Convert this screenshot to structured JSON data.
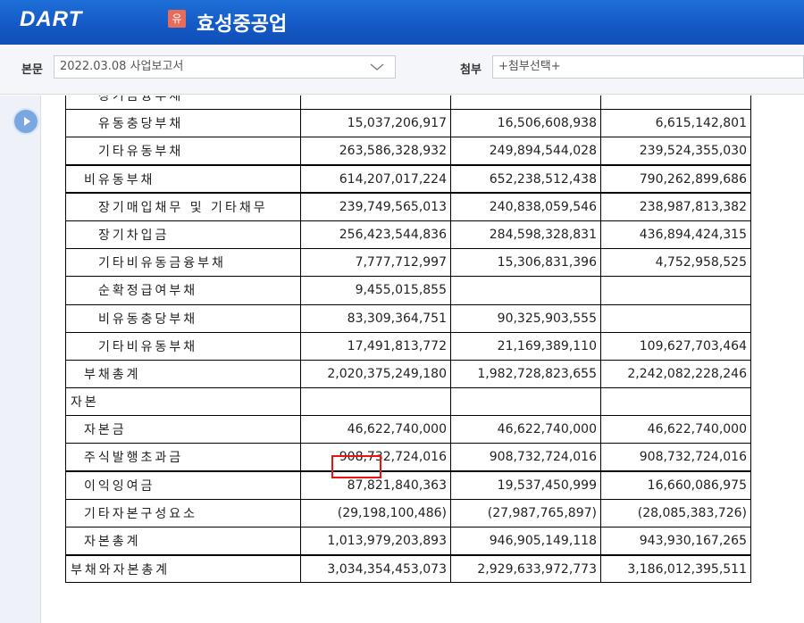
{
  "header": {
    "logo": "DART",
    "badge": "유",
    "company": "효성중공업"
  },
  "toolbar": {
    "main_label": "본문",
    "main_select": "2022.03.08   사업보고서",
    "attach_label": "첨부",
    "attach_select": "+첨부선택+"
  },
  "table": {
    "rows": [
      {
        "label": "장기금융부채 (partially visible)",
        "indent": 2,
        "v1": "",
        "v2": "",
        "v3": ""
      },
      {
        "label": "유동충당부채",
        "indent": 2,
        "v1": "15,037,206,917",
        "v2": "16,506,608,938",
        "v3": "6,615,142,801"
      },
      {
        "label": "기타유동부채",
        "indent": 2,
        "v1": "263,586,328,932",
        "v2": "249,894,544,028",
        "v3": "239,524,355,030"
      },
      {
        "label": "비유동부채",
        "indent": 1,
        "v1": "614,207,017,224",
        "v2": "652,238,512,438",
        "v3": "790,262,899,686"
      },
      {
        "label": "장기매입채무 및 기타채무",
        "indent": 2,
        "v1": "239,749,565,013",
        "v2": "240,838,059,546",
        "v3": "238,987,813,382"
      },
      {
        "label": "장기차입금",
        "indent": 2,
        "v1": "256,423,544,836",
        "v2": "284,598,328,831",
        "v3": "436,894,424,315"
      },
      {
        "label": "기타비유동금융부채",
        "indent": 2,
        "v1": "7,777,712,997",
        "v2": "15,306,831,396",
        "v3": "4,752,958,525"
      },
      {
        "label": "순확정급여부채",
        "indent": 2,
        "v1": "9,455,015,855",
        "v2": "",
        "v3": ""
      },
      {
        "label": "비유동충당부채",
        "indent": 2,
        "v1": "83,309,364,751",
        "v2": "90,325,903,555",
        "v3": ""
      },
      {
        "label": "기타비유동부채",
        "indent": 2,
        "v1": "17,491,813,772",
        "v2": "21,169,389,110",
        "v3": "109,627,703,464"
      },
      {
        "label": "부채총계",
        "indent": 1,
        "v1": "2,020,375,249,180",
        "v2": "1,982,728,823,655",
        "v3": "2,242,082,228,246"
      },
      {
        "label": "자본",
        "indent": 0,
        "v1": "",
        "v2": "",
        "v3": ""
      },
      {
        "label": "자본금",
        "indent": 1,
        "v1": "46,622,740,000",
        "v2": "46,622,740,000",
        "v3": "46,622,740,000"
      },
      {
        "label": "주식발행초과금",
        "indent": 1,
        "v1": "908,732,724,016",
        "v2": "908,732,724,016",
        "v3": "908,732,724,016"
      },
      {
        "label": "이익잉여금",
        "indent": 1,
        "v1": "87,821,840,363",
        "v2": "19,537,450,999",
        "v3": "16,660,086,975"
      },
      {
        "label": "기타자본구성요소",
        "indent": 1,
        "v1": "(29,198,100,486)",
        "v2": "(27,987,765,897)",
        "v3": "(28,085,383,726)"
      },
      {
        "label": "자본총계",
        "indent": 1,
        "v1": "1,013,979,203,893",
        "v2": "946,905,149,118",
        "v3": "943,930,167,265"
      },
      {
        "label": "부채와자본총계",
        "indent": 0,
        "v1": "3,034,354,453,073",
        "v2": "2,929,633,972,773",
        "v3": "3,186,012,395,511"
      }
    ]
  }
}
